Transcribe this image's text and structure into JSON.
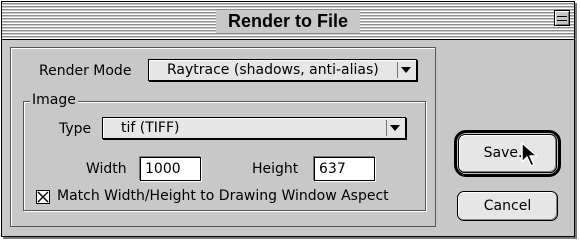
{
  "window": {
    "title": "Render to File"
  },
  "render_mode": {
    "label": "Render Mode",
    "value": "Raytrace (shadows, anti-alias)"
  },
  "image_group": {
    "title": "Image",
    "type_label": "Type",
    "type_value": "tif (TIFF)",
    "width_label": "Width",
    "width_value": "1000",
    "height_label": "Height",
    "height_value": "637",
    "match_label": "Match Width/Height to Drawing Window Aspect",
    "match_checked": true
  },
  "buttons": {
    "save": "Save...",
    "cancel": "Cancel"
  },
  "icons": {
    "collapse": "collapse-box-icon",
    "dropdown": "chevron-down-icon",
    "checkbox": "x-check-icon",
    "cursor": "arrow-cursor-icon"
  }
}
